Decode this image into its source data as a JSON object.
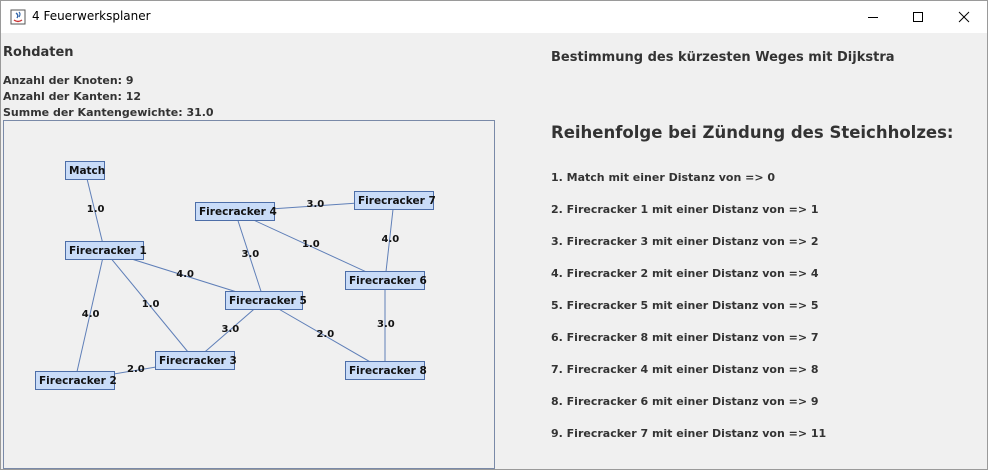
{
  "window": {
    "title": "4 Feuerwerksplaner",
    "app_icon": "java-icon",
    "controls": [
      "minimize-icon",
      "maximize-icon",
      "close-icon"
    ]
  },
  "raw": {
    "heading": "Rohdaten",
    "nodes_count": "Anzahl der Knoten: 9",
    "edges_count": "Anzahl der Kanten: 12",
    "weight_sum": "Summe der Kantengewichte: 31.0"
  },
  "graph": {
    "nodes": [
      {
        "id": "match",
        "label": "Match"
      },
      {
        "id": "f1",
        "label": "Firecracker 1"
      },
      {
        "id": "f2",
        "label": "Firecracker 2"
      },
      {
        "id": "f3",
        "label": "Firecracker 3"
      },
      {
        "id": "f4",
        "label": "Firecracker 4"
      },
      {
        "id": "f5",
        "label": "Firecracker 5"
      },
      {
        "id": "f6",
        "label": "Firecracker 6"
      },
      {
        "id": "f7",
        "label": "Firecracker 7"
      },
      {
        "id": "f8",
        "label": "Firecracker 8"
      }
    ],
    "edges": [
      {
        "from": "match",
        "to": "f1",
        "weight": "1.0"
      },
      {
        "from": "f1",
        "to": "f2",
        "weight": "4.0"
      },
      {
        "from": "f1",
        "to": "f3",
        "weight": "1.0"
      },
      {
        "from": "f1",
        "to": "f5",
        "weight": "4.0"
      },
      {
        "from": "f2",
        "to": "f3",
        "weight": "2.0"
      },
      {
        "from": "f3",
        "to": "f5",
        "weight": "3.0"
      },
      {
        "from": "f4",
        "to": "f5",
        "weight": "3.0"
      },
      {
        "from": "f4",
        "to": "f7",
        "weight": "3.0"
      },
      {
        "from": "f4",
        "to": "f6",
        "weight": "1.0"
      },
      {
        "from": "f7",
        "to": "f6",
        "weight": "4.0"
      },
      {
        "from": "f6",
        "to": "f8",
        "weight": "3.0"
      },
      {
        "from": "f5",
        "to": "f8",
        "weight": "2.0"
      }
    ]
  },
  "dijkstra": {
    "title": "Bestimmung des kürzesten Weges mit Dijkstra",
    "order_title": "Reihenfolge bei Zündung des Steichholzes:",
    "items": [
      "1. Match mit einer Distanz von => 0",
      "2. Firecracker 1 mit einer Distanz von => 1",
      "3. Firecracker 3 mit einer Distanz von => 2",
      "4. Firecracker 2 mit einer Distanz von => 4",
      "5. Firecracker 5 mit einer Distanz von => 5",
      "6. Firecracker 8 mit einer Distanz von => 7",
      "7. Firecracker 4 mit einer Distanz von => 8",
      "8. Firecracker 6 mit einer Distanz von => 9",
      "9. Firecracker 7 mit einer Distanz von => 11"
    ]
  }
}
